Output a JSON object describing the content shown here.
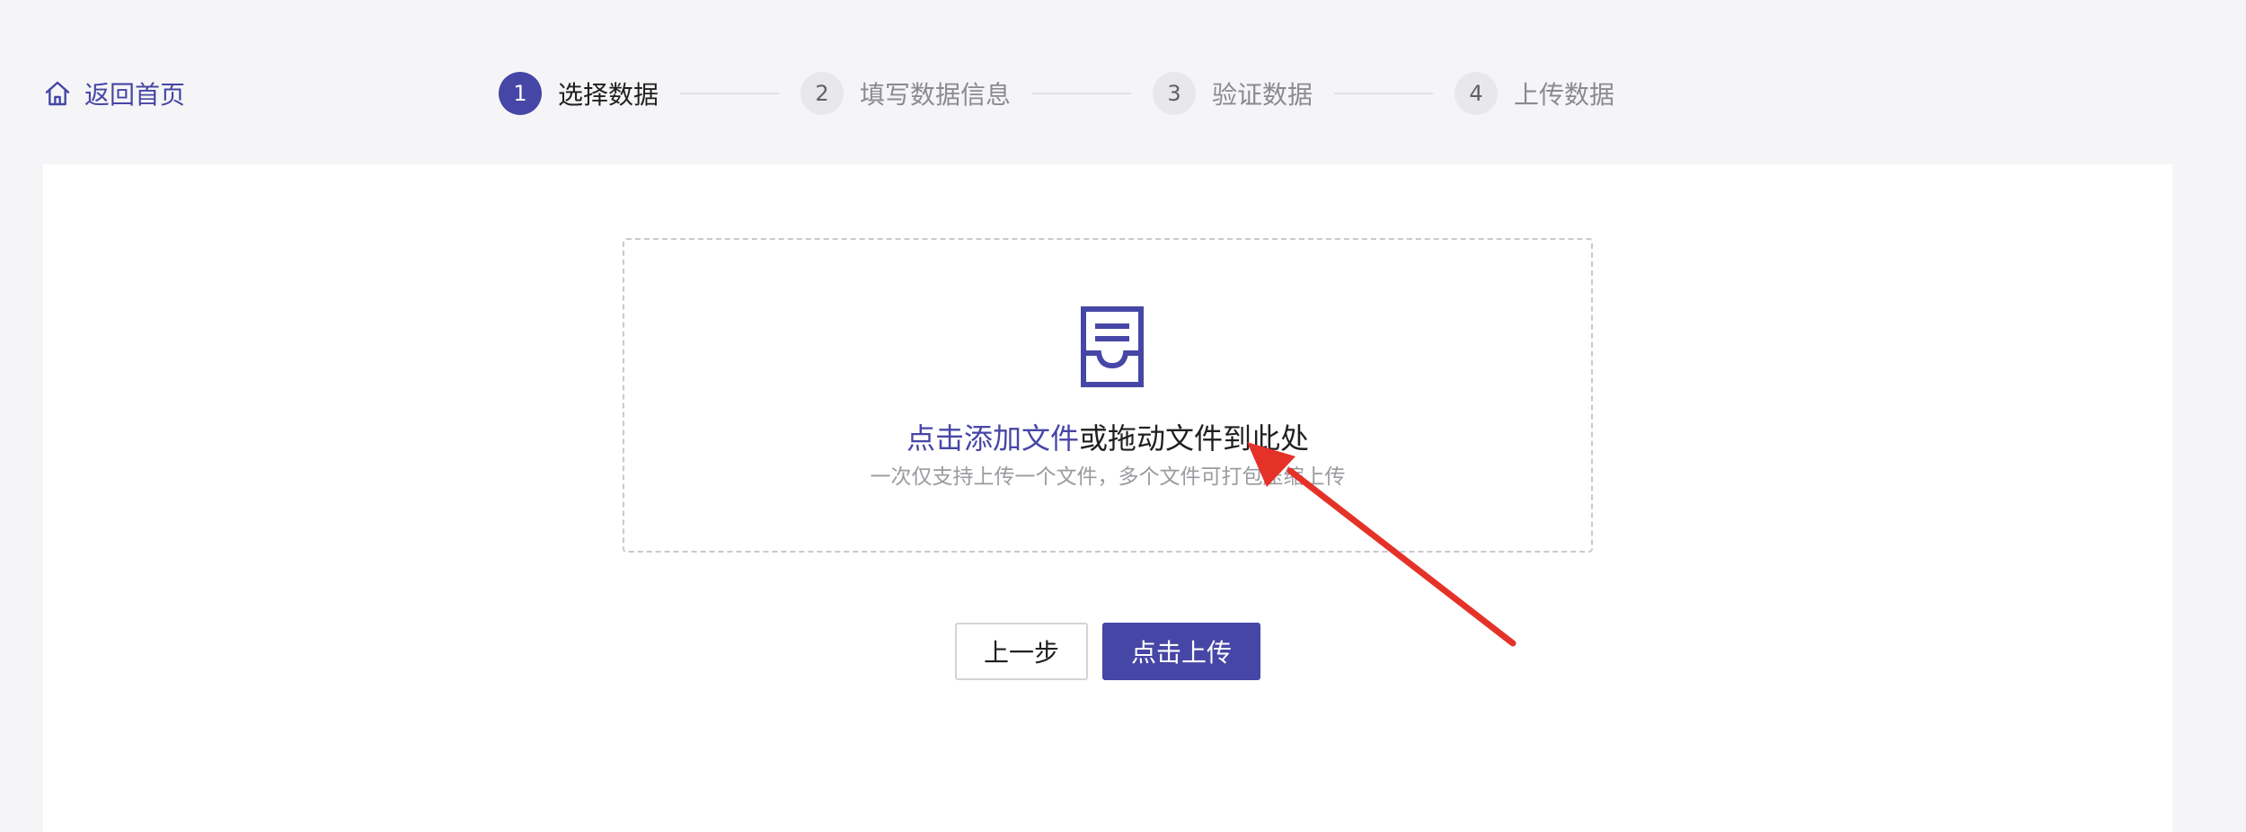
{
  "header": {
    "back_home_label": "返回首页",
    "back_home_icon": "home-icon"
  },
  "steps": [
    {
      "number": "1",
      "label": "选择数据",
      "active": true
    },
    {
      "number": "2",
      "label": "填写数据信息",
      "active": false
    },
    {
      "number": "3",
      "label": "验证数据",
      "active": false
    },
    {
      "number": "4",
      "label": "上传数据",
      "active": false
    }
  ],
  "dropzone": {
    "icon": "file-tray-icon",
    "link_text": "点击添加文件",
    "rest_text": "或拖动文件到此处",
    "hint": "一次仅支持上传一个文件，多个文件可打包压缩上传"
  },
  "buttons": {
    "prev_label": "上一步",
    "upload_label": "点击上传"
  },
  "colors": {
    "accent": "#4646a6",
    "background": "#f5f5f7",
    "panel": "#ffffff",
    "annotation_arrow": "#e53228"
  }
}
